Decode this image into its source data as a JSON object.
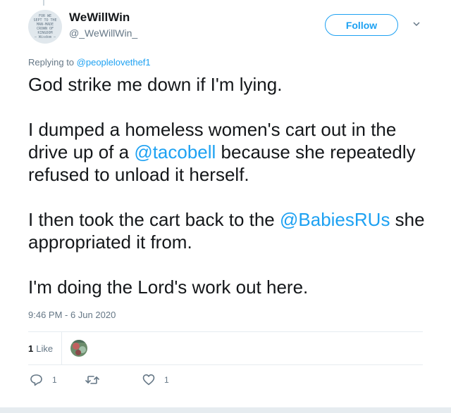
{
  "author": {
    "display_name": "WeWillWin",
    "handle": "@_WeWillWin_",
    "avatar_text": [
      "FOR WE",
      "SEPT TO THE",
      "MAN-MADE",
      "CROWN OF",
      "KINGDOM",
      "— Wisdom —"
    ]
  },
  "follow_label": "Follow",
  "replying": {
    "prefix": "Replying to ",
    "mention": "@peoplelovethef1"
  },
  "tweet": {
    "p1": "God strike me down if I'm lying.",
    "p2_a": "I dumped a homeless women's cart out in the drive up of a ",
    "p2_mention": "@tacobell",
    "p2_b": " because she repeatedly refused to unload it herself.",
    "p3_a": "I then took the cart back to the ",
    "p3_mention": "@BabiesRUs",
    "p3_b": " she appropriated it from.",
    "p4": "I'm doing the Lord's work out here."
  },
  "timestamp": "9:46 PM - 6 Jun 2020",
  "likes": {
    "count": "1",
    "label": "Like"
  },
  "actions": {
    "reply_count": "1",
    "like_count": "1"
  },
  "icons": [
    "caret-down-icon",
    "reply-icon",
    "retweet-icon",
    "heart-icon"
  ],
  "colors": {
    "accent": "#1da1f2",
    "muted": "#657786",
    "divider": "#e6ecf0"
  }
}
